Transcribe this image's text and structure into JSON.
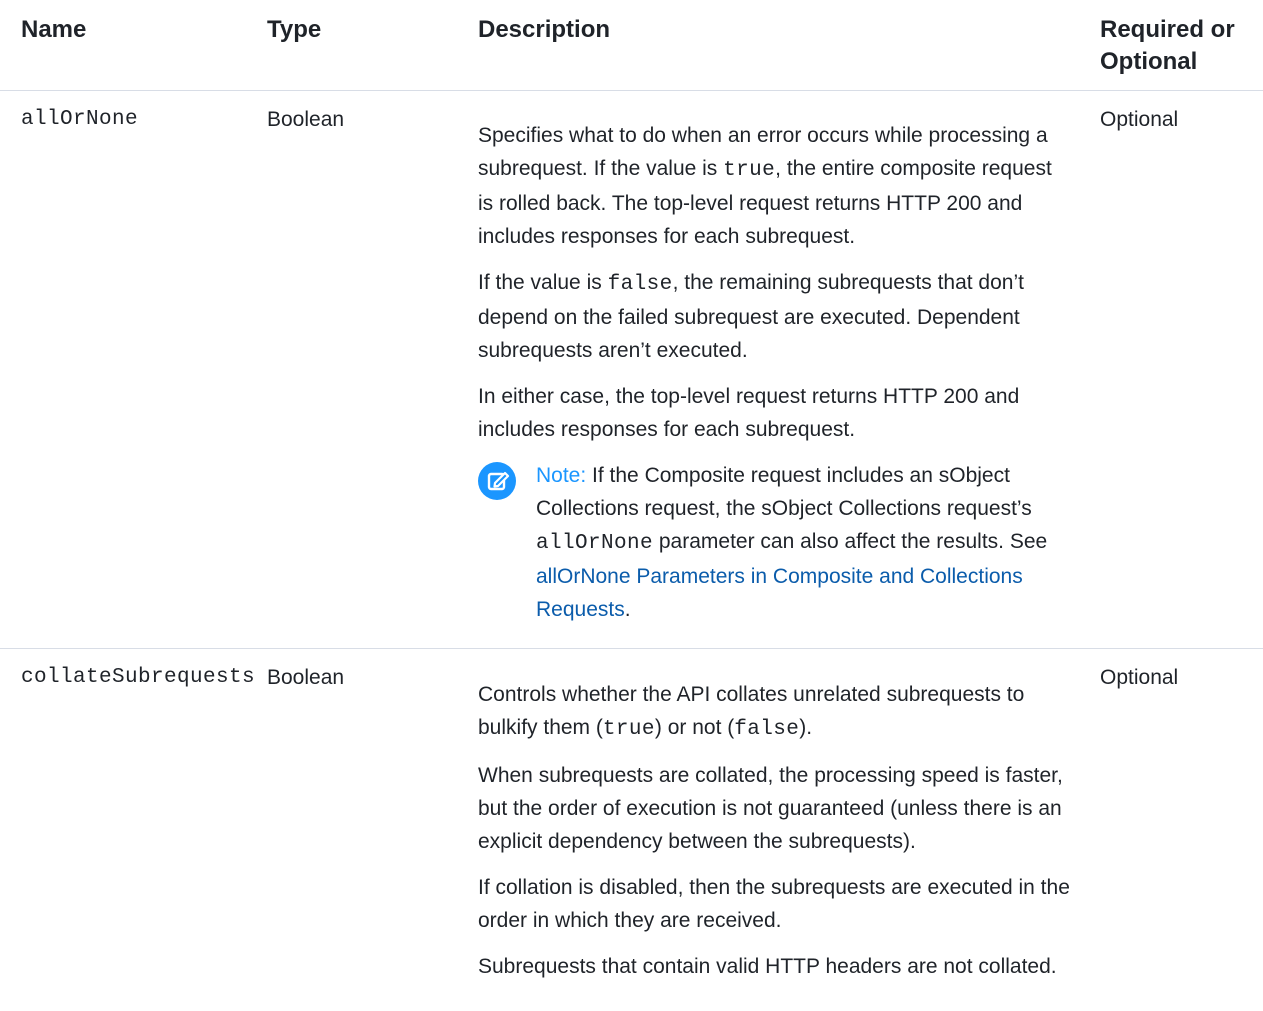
{
  "table": {
    "headers": {
      "name": "Name",
      "type": "Type",
      "description": "Description",
      "required_line1": "Required or",
      "required_line2": "Optional"
    },
    "rows": [
      {
        "name": "allOrNone",
        "type": "Boolean",
        "required": "Optional",
        "desc": {
          "p1_a": "Specifies what to do when an error occurs while processing a subrequest. If the value is ",
          "p1_code": "true",
          "p1_b": ", the entire composite request is rolled back. The top-level request returns HTTP 200 and includes responses for each subrequest.",
          "p2_a": "If the value is ",
          "p2_code": "false",
          "p2_b": ", the remaining subrequests that don’t depend on the failed subrequest are executed. Dependent subrequests aren’t executed.",
          "p3": "In either case, the top-level request returns HTTP 200 and includes responses for each subrequest.",
          "note": {
            "icon": "edit-note-icon",
            "label": "Note:",
            "text_a": " If the Composite request includes an sObject Collections request, the sObject Collections request’s ",
            "code": "allOrNone",
            "text_b": " parameter can also affect the results. See ",
            "link": "allOrNone Parameters in Composite and Collections Requests",
            "text_c": "."
          }
        }
      },
      {
        "name": "collateSubrequests",
        "type": "Boolean",
        "required": "Optional",
        "desc": {
          "p1_a": "Controls whether the API collates unrelated subrequests to bulkify them (",
          "p1_code1": "true",
          "p1_b": ") or not (",
          "p1_code2": "false",
          "p1_c": ").",
          "p2": "When subrequests are collated, the processing speed is faster, but the order of execution is not guaranteed (unless there is an explicit dependency between the subrequests).",
          "p3": "If collation is disabled, then the subrequests are executed in the order in which they are received.",
          "p4": "Subrequests that contain valid HTTP headers are not collated."
        }
      }
    ]
  },
  "colors": {
    "text": "#1f2329",
    "accent": "#1b96ff",
    "link": "#0b5cab",
    "divider": "#d8dde6"
  }
}
